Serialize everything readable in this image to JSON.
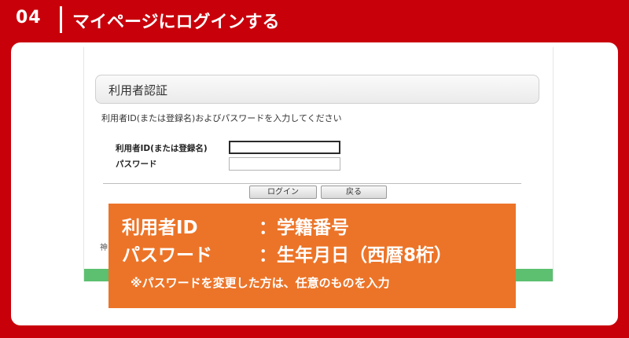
{
  "header": {
    "step_number": "04",
    "title": "マイページにログインする"
  },
  "login_screen": {
    "section_title": "利用者認証",
    "instruction": "利用者ID(または登録名)およびパスワードを入力してください",
    "fields": {
      "user_id_label": "利用者ID(または登録名)",
      "user_id_value": "",
      "password_label": "パスワード",
      "password_value": ""
    },
    "buttons": {
      "login": "ログイン",
      "back": "戻る"
    },
    "footer_partial": "神"
  },
  "callout": {
    "user_id_key": "利用者ID",
    "user_id_value": "：学籍番号",
    "password_key": "パスワード",
    "password_value": "：生年月日（西暦8桁）",
    "note": "※パスワードを変更した方は、任意のものを入力"
  },
  "colors": {
    "brand_red": "#c8000a",
    "callout_orange": "#ec7428",
    "footer_green": "#5cc070"
  }
}
